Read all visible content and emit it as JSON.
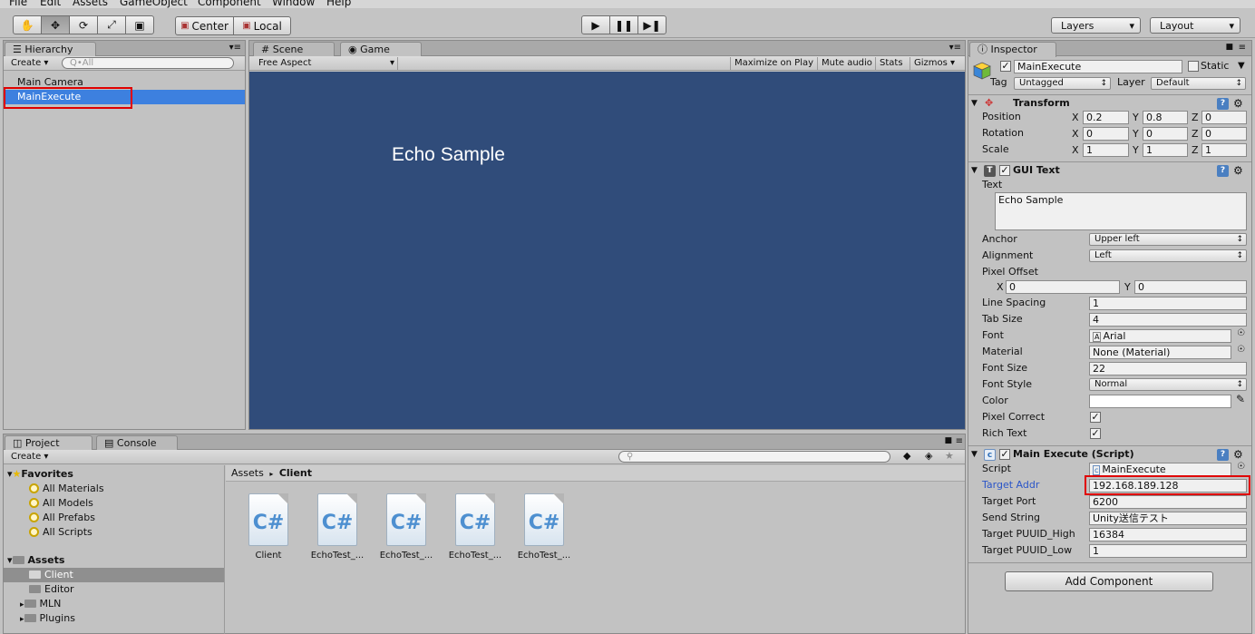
{
  "menu": [
    "File",
    "Edit",
    "Assets",
    "GameObject",
    "Component",
    "Window",
    "Help"
  ],
  "toolbar": {
    "tools": [
      "hand-icon",
      "move-icon",
      "rotate-icon",
      "scale-icon",
      "rect-icon"
    ],
    "pivot": "Center",
    "space": "Local",
    "play": [
      "play-icon",
      "pause-icon",
      "step-icon"
    ],
    "layers": "Layers",
    "layout": "Layout"
  },
  "hierarchy": {
    "tab": "Hierarchy",
    "create": "Create",
    "search_placeholder": "Q•All",
    "items": [
      "Main Camera",
      "MainExecute"
    ]
  },
  "scene_tabs": {
    "scene": "Scene",
    "game": "Game"
  },
  "game": {
    "aspect": "Free Aspect",
    "buttons": [
      "Maximize on Play",
      "Mute audio",
      "Stats",
      "Gizmos"
    ],
    "display_text": "Echo Sample",
    "bg_color": "#304c7a"
  },
  "project": {
    "tab": "Project",
    "console_tab": "Console",
    "create": "Create",
    "favorites_label": "Favorites",
    "favorites": [
      "All Materials",
      "All Models",
      "All Prefabs",
      "All Scripts"
    ],
    "assets_label": "Assets",
    "assets": [
      "Client",
      "Editor",
      "MLN",
      "Plugins"
    ],
    "breadcrumb": [
      "Assets",
      "Client"
    ],
    "files": [
      "Client",
      "EchoTest_...",
      "EchoTest_...",
      "EchoTest_...",
      "EchoTest_..."
    ],
    "file_glyph": "C#"
  },
  "inspector": {
    "tab": "Inspector",
    "object_name": "MainExecute",
    "static_label": "Static",
    "tag_label": "Tag",
    "tag_value": "Untagged",
    "layer_label": "Layer",
    "layer_value": "Default",
    "transform": {
      "title": "Transform",
      "rows": [
        {
          "label": "Position",
          "x": "0.2",
          "y": "0.8",
          "z": "0"
        },
        {
          "label": "Rotation",
          "x": "0",
          "y": "0",
          "z": "0"
        },
        {
          "label": "Scale",
          "x": "1",
          "y": "1",
          "z": "1"
        }
      ],
      "axes": [
        "X",
        "Y",
        "Z"
      ]
    },
    "gui_text": {
      "title": "GUI Text",
      "text_label": "Text",
      "text_value": "Echo Sample",
      "anchor_label": "Anchor",
      "anchor_value": "Upper left",
      "alignment_label": "Alignment",
      "alignment_value": "Left",
      "pixel_offset_label": "Pixel Offset",
      "offset_x": "0",
      "offset_y": "0",
      "line_spacing_label": "Line Spacing",
      "line_spacing": "1",
      "tab_size_label": "Tab Size",
      "tab_size": "4",
      "font_label": "Font",
      "font_value": "Arial",
      "material_label": "Material",
      "material_value": "None (Material)",
      "font_size_label": "Font Size",
      "font_size": "22",
      "font_style_label": "Font Style",
      "font_style": "Normal",
      "color_label": "Color",
      "pixel_correct_label": "Pixel Correct",
      "rich_text_label": "Rich Text"
    },
    "script": {
      "title": "Main Execute (Script)",
      "script_label": "Script",
      "script_value": "MainExecute",
      "target_addr_label": "Target Addr",
      "target_addr": "192.168.189.128",
      "target_port_label": "Target Port",
      "target_port": "6200",
      "send_string_label": "Send String",
      "send_string": "Unity送信テスト",
      "puuid_high_label": "Target PUUID_High",
      "puuid_high": "16384",
      "puuid_low_label": "Target PUUID_Low",
      "puuid_low": "1"
    },
    "add_component": "Add Component"
  },
  "colors": {
    "selection": "#3d80df",
    "highlight_box": "#e00000",
    "game_bg": "#304c7a",
    "link_label": "#2a55c8"
  }
}
